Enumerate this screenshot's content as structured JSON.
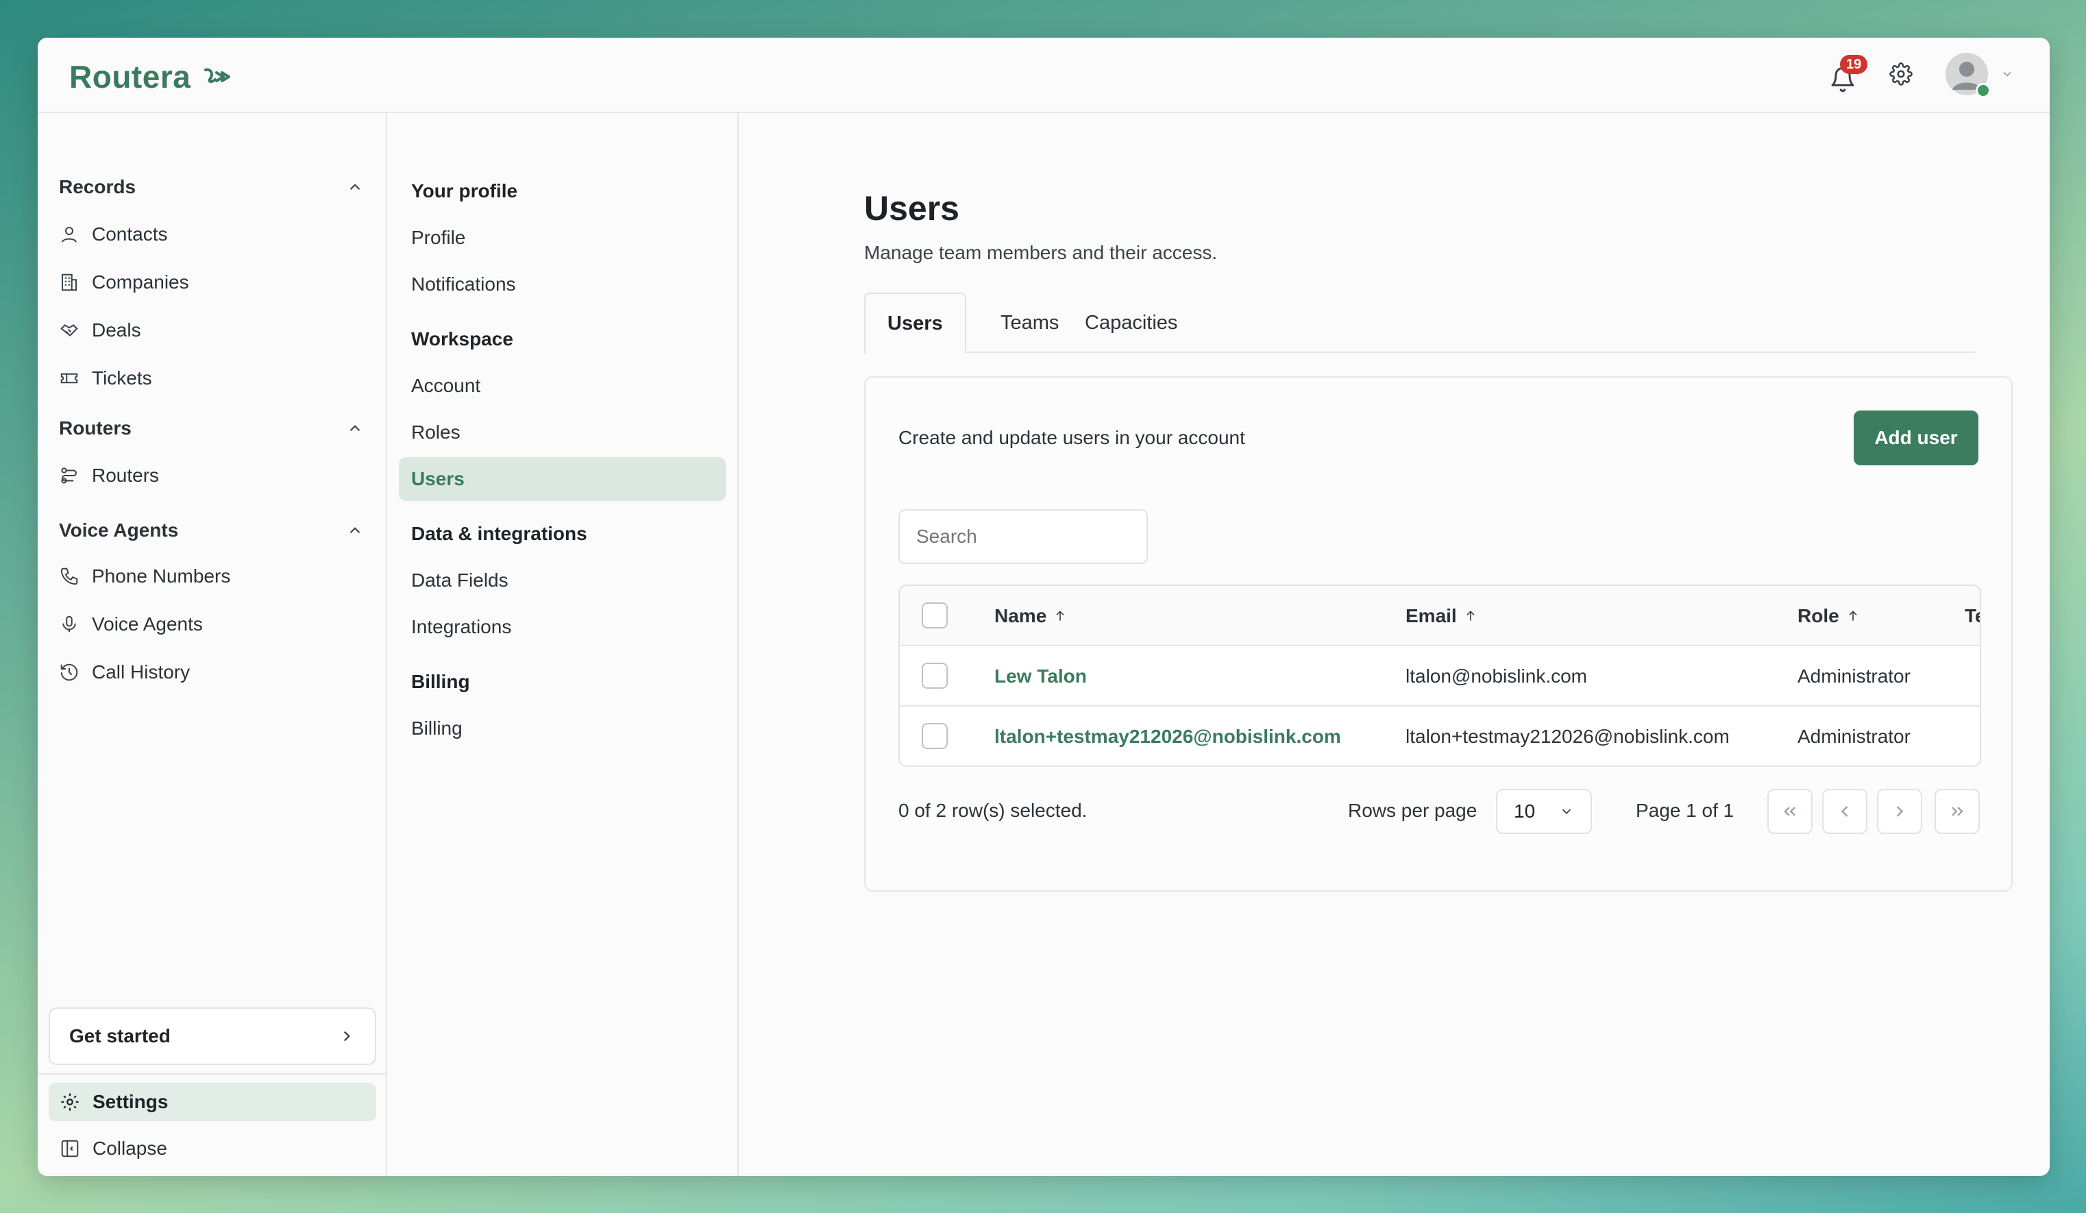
{
  "app": {
    "logo_text": "Routera"
  },
  "topbar": {
    "notification_count": "19"
  },
  "leftnav": {
    "sections": [
      {
        "title": "Records",
        "items": [
          "Contacts",
          "Companies",
          "Deals",
          "Tickets"
        ]
      },
      {
        "title": "Routers",
        "items": [
          "Routers"
        ]
      },
      {
        "title": "Voice Agents",
        "items": [
          "Phone Numbers",
          "Voice Agents",
          "Call History"
        ]
      }
    ],
    "get_started": "Get started",
    "settings": "Settings",
    "collapse": "Collapse"
  },
  "subnav": {
    "your_profile": "Your profile",
    "profile": "Profile",
    "notifications": "Notifications",
    "workspace": "Workspace",
    "account": "Account",
    "roles": "Roles",
    "users": "Users",
    "data_integrations": "Data & integrations",
    "data_fields": "Data Fields",
    "integrations": "Integrations",
    "billing_head": "Billing",
    "billing": "Billing"
  },
  "main": {
    "title": "Users",
    "subtitle": "Manage team members and their access.",
    "tabs": [
      "Users",
      "Teams",
      "Capacities"
    ],
    "card_desc": "Create and update users in your account",
    "add_user": "Add user",
    "search_placeholder": "Search",
    "table": {
      "headers": [
        "Name",
        "Email",
        "Role",
        "Team"
      ],
      "rows": [
        {
          "name": "Lew Talon",
          "email": "ltalon@nobislink.com",
          "role": "Administrator"
        },
        {
          "name": "ltalon+testmay212026@nobislink.com",
          "email": "ltalon+testmay212026@nobislink.com",
          "role": "Administrator"
        }
      ]
    },
    "pager": {
      "selected": "0 of 2 row(s) selected.",
      "rows_per_page_label": "Rows per page",
      "rows_per_page": "10",
      "page_label": "Page 1 of 1"
    }
  }
}
